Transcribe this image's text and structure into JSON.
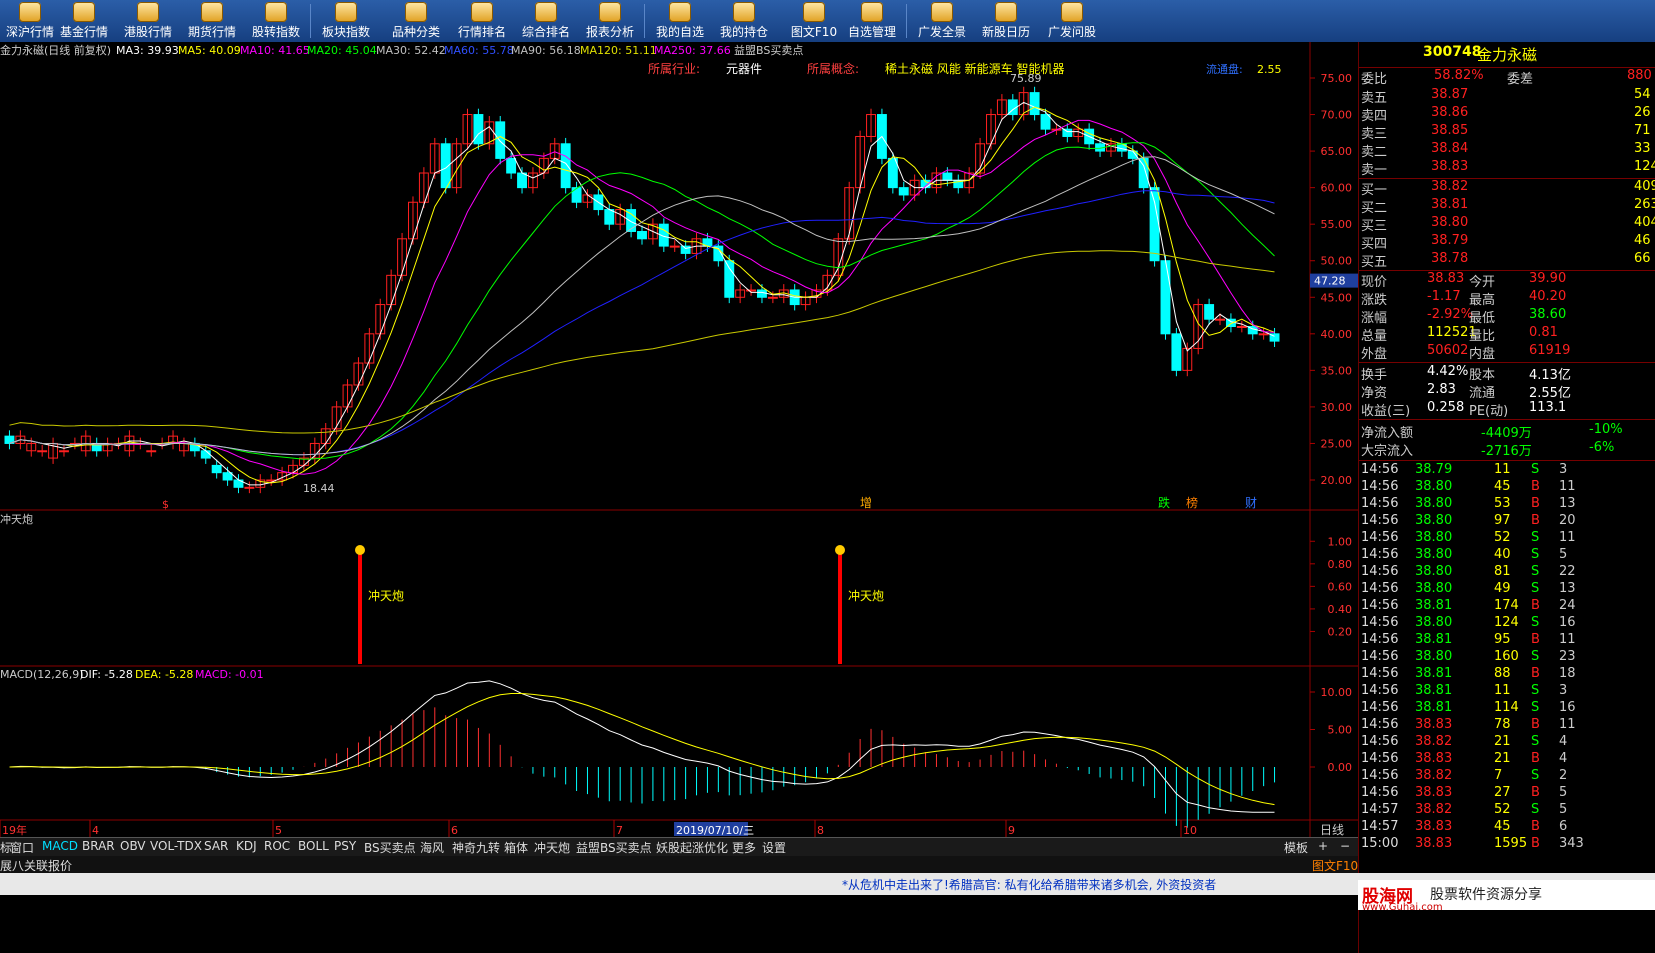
{
  "toolbar": {
    "items": [
      {
        "label": "深沪行情"
      },
      {
        "label": "基金行情"
      },
      {
        "label": "港股行情"
      },
      {
        "label": "期货行情"
      },
      {
        "label": "股转指数"
      },
      {
        "label": "板块指数"
      },
      {
        "label": "品种分类"
      },
      {
        "label": "行情排名"
      },
      {
        "label": "综合排名"
      },
      {
        "label": "报表分析"
      },
      {
        "label": "我的自选"
      },
      {
        "label": "我的持仓"
      },
      {
        "label": "图文F10"
      },
      {
        "label": "自选管理"
      },
      {
        "label": "广发全景"
      },
      {
        "label": "新股日历"
      },
      {
        "label": "广发问股"
      }
    ]
  },
  "chart_header": {
    "title": "金力永磁(日线 前复权)",
    "ma3": "MA3: 39.93",
    "ma5": "MA5: 40.09",
    "ma10": "MA10: 41.65",
    "ma20": "MA20: 45.04",
    "ma30": "MA30: 52.42",
    "ma60": "MA60: 55.78",
    "ma90": "MA90: 56.18",
    "ma120": "MA120: 51.11",
    "ma250": "MA250: 37.66",
    "bs_label": "益盟BS买卖点",
    "industry_label": "所属行业:",
    "industry": "元器件",
    "concept_label": "所属概念:",
    "concept": "稀土永磁 风能 新能源车 智能机器",
    "float_label": "流通盘:",
    "float_value": "2.55",
    "high_label": "75.89",
    "low_label": "18.44",
    "current_price_tag": "47.28"
  },
  "price_axis": [
    "75.00",
    "70.00",
    "65.00",
    "60.00",
    "55.00",
    "50.00",
    "45.00",
    "40.00",
    "35.00",
    "30.00",
    "25.00",
    "20.00"
  ],
  "event_markers": {
    "s_mark": "$",
    "zeng": "增",
    "die": "跌",
    "bang": "榜",
    "cai": "财"
  },
  "indicator1": {
    "title": "冲天炮",
    "axis": [
      "1.00",
      "0.80",
      "0.60",
      "0.40",
      "0.20"
    ],
    "signal_label_1": "冲天炮",
    "signal_label_2": "冲天炮"
  },
  "macd": {
    "title": "MACD(12,26,9)",
    "dif": "DIF: -5.28",
    "dea": "DEA: -5.28",
    "macd": "MACD: -0.01",
    "axis": [
      "10.00",
      "5.00",
      "0.00"
    ]
  },
  "date_axis": {
    "labels": [
      "19年",
      "4",
      "5",
      "6",
      "7",
      "8",
      "9",
      "10"
    ],
    "highlight": "2019/07/10/三",
    "period": "日线"
  },
  "bottom_tabs": [
    "标",
    "窗口",
    "MACD",
    "BRAR",
    "OBV",
    "VOL-TDX",
    "SAR",
    "KDJ",
    "ROC",
    "BOLL",
    "PSY",
    "BS买卖点",
    "海风",
    "神奇九转",
    "箱体",
    "冲天炮",
    "益盟BS买卖点",
    "妖股起涨优化",
    "更多",
    "设置"
  ],
  "bottom_right": {
    "template": "模板",
    "plus": "+",
    "minus": "−"
  },
  "row2_tabs": [
    "展八",
    "关联报价"
  ],
  "right_panel": {
    "code": "300748",
    "name": "金力永磁",
    "weibi_label": "委比",
    "weibi": "58.82%",
    "weicha_label": "委差",
    "weicha": "880",
    "asks": [
      {
        "label": "卖五",
        "price": "38.87",
        "vol": "54"
      },
      {
        "label": "卖四",
        "price": "38.86",
        "vol": "26"
      },
      {
        "label": "卖三",
        "price": "38.85",
        "vol": "71"
      },
      {
        "label": "卖二",
        "price": "38.84",
        "vol": "33"
      },
      {
        "label": "卖一",
        "price": "38.83",
        "vol": "124"
      }
    ],
    "bids": [
      {
        "label": "买一",
        "price": "38.82",
        "vol": "409"
      },
      {
        "label": "买二",
        "price": "38.81",
        "vol": "263"
      },
      {
        "label": "买三",
        "price": "38.80",
        "vol": "404"
      },
      {
        "label": "买四",
        "price": "38.79",
        "vol": "46"
      },
      {
        "label": "买五",
        "price": "38.78",
        "vol": "66"
      }
    ],
    "quote": [
      {
        "l1": "现价",
        "v1": "38.83",
        "l2": "今开",
        "v2": "39.90"
      },
      {
        "l1": "涨跌",
        "v1": "-1.17",
        "l2": "最高",
        "v2": "40.20"
      },
      {
        "l1": "涨幅",
        "v1": "-2.92%",
        "l2": "最低",
        "v2": "38.60"
      },
      {
        "l1": "总量",
        "v1": "112521",
        "l2": "量比",
        "v2": "0.81"
      },
      {
        "l1": "外盘",
        "v1": "50602",
        "l2": "内盘",
        "v2": "61919"
      }
    ],
    "stats": [
      {
        "l1": "换手",
        "v1": "4.42%",
        "l2": "股本",
        "v2": "4.13亿"
      },
      {
        "l1": "净资",
        "v1": "2.83",
        "l2": "流通",
        "v2": "2.55亿"
      },
      {
        "l1": "收益(三)",
        "v1": "0.258",
        "l2": "PE(动)",
        "v2": "113.1"
      }
    ],
    "flow": [
      {
        "label": "净流入额",
        "value": "-4409万",
        "pct": "-10%"
      },
      {
        "label": "大宗流入",
        "value": "-2716万",
        "pct": "-6%"
      }
    ],
    "ticks": [
      {
        "t": "14:56",
        "p": "38.79",
        "v": "11",
        "d": "S",
        "n": "3"
      },
      {
        "t": "14:56",
        "p": "38.80",
        "v": "45",
        "d": "B",
        "n": "11"
      },
      {
        "t": "14:56",
        "p": "38.80",
        "v": "53",
        "d": "B",
        "n": "13"
      },
      {
        "t": "14:56",
        "p": "38.80",
        "v": "97",
        "d": "B",
        "n": "20"
      },
      {
        "t": "14:56",
        "p": "38.80",
        "v": "52",
        "d": "S",
        "n": "11"
      },
      {
        "t": "14:56",
        "p": "38.80",
        "v": "40",
        "d": "S",
        "n": "5"
      },
      {
        "t": "14:56",
        "p": "38.80",
        "v": "81",
        "d": "S",
        "n": "22"
      },
      {
        "t": "14:56",
        "p": "38.80",
        "v": "49",
        "d": "S",
        "n": "13"
      },
      {
        "t": "14:56",
        "p": "38.81",
        "v": "174",
        "d": "B",
        "n": "24"
      },
      {
        "t": "14:56",
        "p": "38.80",
        "v": "124",
        "d": "S",
        "n": "16"
      },
      {
        "t": "14:56",
        "p": "38.81",
        "v": "95",
        "d": "B",
        "n": "11"
      },
      {
        "t": "14:56",
        "p": "38.80",
        "v": "160",
        "d": "S",
        "n": "23"
      },
      {
        "t": "14:56",
        "p": "38.81",
        "v": "88",
        "d": "B",
        "n": "18"
      },
      {
        "t": "14:56",
        "p": "38.81",
        "v": "11",
        "d": "S",
        "n": "3"
      },
      {
        "t": "14:56",
        "p": "38.81",
        "v": "114",
        "d": "S",
        "n": "16"
      },
      {
        "t": "14:56",
        "p": "38.83",
        "v": "78",
        "d": "B",
        "n": "11"
      },
      {
        "t": "14:56",
        "p": "38.82",
        "v": "21",
        "d": "S",
        "n": "4"
      },
      {
        "t": "14:56",
        "p": "38.83",
        "v": "21",
        "d": "B",
        "n": "4"
      },
      {
        "t": "14:56",
        "p": "38.82",
        "v": "7",
        "d": "S",
        "n": "2"
      },
      {
        "t": "14:56",
        "p": "38.83",
        "v": "27",
        "d": "B",
        "n": "5"
      },
      {
        "t": "14:57",
        "p": "38.82",
        "v": "52",
        "d": "S",
        "n": "5"
      },
      {
        "t": "14:57",
        "p": "38.83",
        "v": "45",
        "d": "B",
        "n": "6"
      },
      {
        "t": "15:00",
        "p": "38.83",
        "v": "1595",
        "d": "B",
        "n": "343"
      }
    ],
    "f10": "图文F10"
  },
  "ticker_news": "*从危机中走出来了!希腊高官: 私有化给希腊带来诸多机会, 外资投资者",
  "watermark": {
    "brand": "股海网",
    "slogan": "股票软件资源分享",
    "url": "www.Guhai.com"
  },
  "colors": {
    "up": "#ff2020",
    "down": "#00ffff",
    "ma3": "#ffffff",
    "ma5": "#ffff00",
    "ma10": "#ff00ff",
    "ma20": "#00ff00",
    "ma60": "#2020ff",
    "ma90": "#c0c0c0",
    "ma250": "#c8c800"
  }
}
